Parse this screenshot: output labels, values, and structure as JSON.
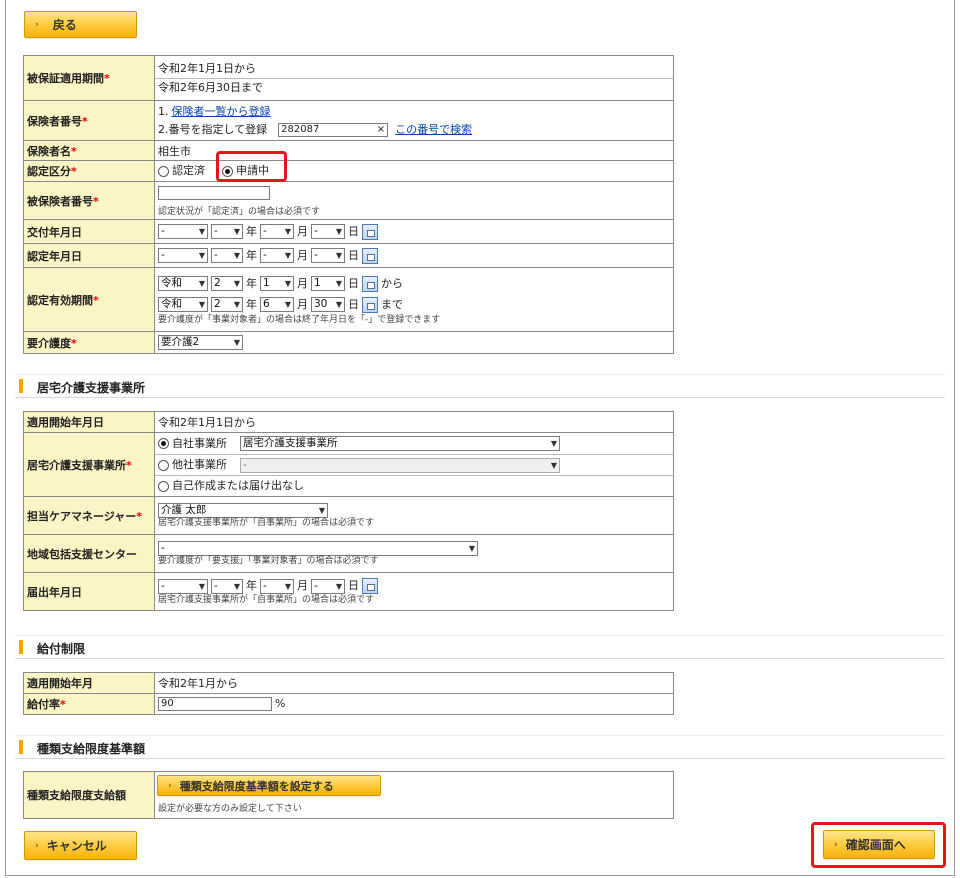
{
  "buttons": {
    "back": "戻る",
    "cancel": "キャンセル",
    "confirm": "確認画面へ",
    "set_limit": "種類支給限度基準額を設定する"
  },
  "insured": {
    "period_label": "被保証適用期間",
    "period_from": "令和2年1月1日から",
    "period_to": "令和2年6月30日まで",
    "insurer_no_label": "保険者番号",
    "insurer_link1_prefix": "1.",
    "insurer_link1": "保険者一覧から登録",
    "insurer_opt2": "2.番号を指定して登録",
    "insurer_no_value": "282087",
    "clear_mark": "×",
    "search_link": "この番号で検索",
    "insurer_name_label": "保険者名",
    "insurer_name": "相生市",
    "cert_class_label": "認定区分",
    "cert_done": "認定済",
    "cert_pending": "申請中",
    "insured_no_label": "被保険者番号",
    "insured_no_value": "",
    "insured_no_note": "認定状況が「認定済」の場合は必須です",
    "issue_date_label": "交付年月日",
    "cert_date_label": "認定年月日",
    "validity_label": "認定有効期間",
    "validity_note": "要介護度が「事業対象者」の場合は終了年月日を「-」で登録できます",
    "care_level_label": "要介護度",
    "care_level_value": "要介護2",
    "date_blank": "-",
    "unit_year": "年",
    "unit_month": "月",
    "unit_day": "日",
    "from_suffix": "から",
    "to_suffix": "まで",
    "validity_from": {
      "era": "令和",
      "year": "2",
      "month": "1",
      "day": "1"
    },
    "validity_to": {
      "era": "令和",
      "year": "2",
      "month": "6",
      "day": "30"
    }
  },
  "section_support": {
    "title": "居宅介護支援事業所",
    "start_label": "適用開始年月日",
    "start_value": "令和2年1月1日から",
    "office_label": "居宅介護支援事業所",
    "own_office": "自社事業所",
    "own_office_value": "居宅介護支援事業所",
    "other_office": "他社事業所",
    "other_office_value": "-",
    "self_made": "自己作成または届け出なし",
    "manager_label": "担当ケアマネージャー",
    "manager_value": "介護 太郎",
    "manager_note": "居宅介護支援事業所が「自事業所」の場合は必須です",
    "center_label": "地域包括支援センター",
    "center_value": "-",
    "center_note": "要介護度が「要支援」「事業対象者」の場合は必須です",
    "notify_label": "届出年月日",
    "notify_note": "居宅介護支援事業所が「自事業所」の場合は必須です"
  },
  "section_benefit": {
    "title": "給付制限",
    "start_label": "適用開始年月",
    "start_value": "令和2年1月から",
    "rate_label": "給付率",
    "rate_value": "90",
    "rate_unit": "%"
  },
  "section_limit": {
    "title": "種類支給限度基準額",
    "row_label": "種類支給限度支給額",
    "note": "設定が必要な方のみ設定して下さい"
  },
  "required_mark": "*",
  "colors": {
    "accent": "#fdc93a",
    "label_bg": "#fbf4c4",
    "highlight": "#e8131b",
    "required": "#e60000"
  }
}
